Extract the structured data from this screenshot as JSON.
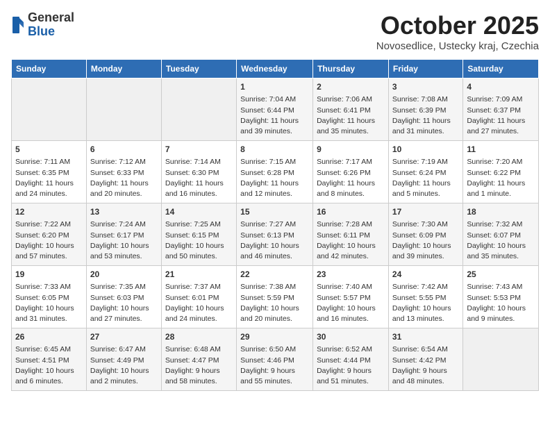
{
  "header": {
    "logo": {
      "general": "General",
      "blue": "Blue"
    },
    "title": "October 2025",
    "location": "Novosedlice, Ustecky kraj, Czechia"
  },
  "weekdays": [
    "Sunday",
    "Monday",
    "Tuesday",
    "Wednesday",
    "Thursday",
    "Friday",
    "Saturday"
  ],
  "weeks": [
    [
      {
        "day": "",
        "info": ""
      },
      {
        "day": "",
        "info": ""
      },
      {
        "day": "",
        "info": ""
      },
      {
        "day": "1",
        "info": "Sunrise: 7:04 AM\nSunset: 6:44 PM\nDaylight: 11 hours and 39 minutes."
      },
      {
        "day": "2",
        "info": "Sunrise: 7:06 AM\nSunset: 6:41 PM\nDaylight: 11 hours and 35 minutes."
      },
      {
        "day": "3",
        "info": "Sunrise: 7:08 AM\nSunset: 6:39 PM\nDaylight: 11 hours and 31 minutes."
      },
      {
        "day": "4",
        "info": "Sunrise: 7:09 AM\nSunset: 6:37 PM\nDaylight: 11 hours and 27 minutes."
      }
    ],
    [
      {
        "day": "5",
        "info": "Sunrise: 7:11 AM\nSunset: 6:35 PM\nDaylight: 11 hours and 24 minutes."
      },
      {
        "day": "6",
        "info": "Sunrise: 7:12 AM\nSunset: 6:33 PM\nDaylight: 11 hours and 20 minutes."
      },
      {
        "day": "7",
        "info": "Sunrise: 7:14 AM\nSunset: 6:30 PM\nDaylight: 11 hours and 16 minutes."
      },
      {
        "day": "8",
        "info": "Sunrise: 7:15 AM\nSunset: 6:28 PM\nDaylight: 11 hours and 12 minutes."
      },
      {
        "day": "9",
        "info": "Sunrise: 7:17 AM\nSunset: 6:26 PM\nDaylight: 11 hours and 8 minutes."
      },
      {
        "day": "10",
        "info": "Sunrise: 7:19 AM\nSunset: 6:24 PM\nDaylight: 11 hours and 5 minutes."
      },
      {
        "day": "11",
        "info": "Sunrise: 7:20 AM\nSunset: 6:22 PM\nDaylight: 11 hours and 1 minute."
      }
    ],
    [
      {
        "day": "12",
        "info": "Sunrise: 7:22 AM\nSunset: 6:20 PM\nDaylight: 10 hours and 57 minutes."
      },
      {
        "day": "13",
        "info": "Sunrise: 7:24 AM\nSunset: 6:17 PM\nDaylight: 10 hours and 53 minutes."
      },
      {
        "day": "14",
        "info": "Sunrise: 7:25 AM\nSunset: 6:15 PM\nDaylight: 10 hours and 50 minutes."
      },
      {
        "day": "15",
        "info": "Sunrise: 7:27 AM\nSunset: 6:13 PM\nDaylight: 10 hours and 46 minutes."
      },
      {
        "day": "16",
        "info": "Sunrise: 7:28 AM\nSunset: 6:11 PM\nDaylight: 10 hours and 42 minutes."
      },
      {
        "day": "17",
        "info": "Sunrise: 7:30 AM\nSunset: 6:09 PM\nDaylight: 10 hours and 39 minutes."
      },
      {
        "day": "18",
        "info": "Sunrise: 7:32 AM\nSunset: 6:07 PM\nDaylight: 10 hours and 35 minutes."
      }
    ],
    [
      {
        "day": "19",
        "info": "Sunrise: 7:33 AM\nSunset: 6:05 PM\nDaylight: 10 hours and 31 minutes."
      },
      {
        "day": "20",
        "info": "Sunrise: 7:35 AM\nSunset: 6:03 PM\nDaylight: 10 hours and 27 minutes."
      },
      {
        "day": "21",
        "info": "Sunrise: 7:37 AM\nSunset: 6:01 PM\nDaylight: 10 hours and 24 minutes."
      },
      {
        "day": "22",
        "info": "Sunrise: 7:38 AM\nSunset: 5:59 PM\nDaylight: 10 hours and 20 minutes."
      },
      {
        "day": "23",
        "info": "Sunrise: 7:40 AM\nSunset: 5:57 PM\nDaylight: 10 hours and 16 minutes."
      },
      {
        "day": "24",
        "info": "Sunrise: 7:42 AM\nSunset: 5:55 PM\nDaylight: 10 hours and 13 minutes."
      },
      {
        "day": "25",
        "info": "Sunrise: 7:43 AM\nSunset: 5:53 PM\nDaylight: 10 hours and 9 minutes."
      }
    ],
    [
      {
        "day": "26",
        "info": "Sunrise: 6:45 AM\nSunset: 4:51 PM\nDaylight: 10 hours and 6 minutes."
      },
      {
        "day": "27",
        "info": "Sunrise: 6:47 AM\nSunset: 4:49 PM\nDaylight: 10 hours and 2 minutes."
      },
      {
        "day": "28",
        "info": "Sunrise: 6:48 AM\nSunset: 4:47 PM\nDaylight: 9 hours and 58 minutes."
      },
      {
        "day": "29",
        "info": "Sunrise: 6:50 AM\nSunset: 4:46 PM\nDaylight: 9 hours and 55 minutes."
      },
      {
        "day": "30",
        "info": "Sunrise: 6:52 AM\nSunset: 4:44 PM\nDaylight: 9 hours and 51 minutes."
      },
      {
        "day": "31",
        "info": "Sunrise: 6:54 AM\nSunset: 4:42 PM\nDaylight: 9 hours and 48 minutes."
      },
      {
        "day": "",
        "info": ""
      }
    ]
  ]
}
